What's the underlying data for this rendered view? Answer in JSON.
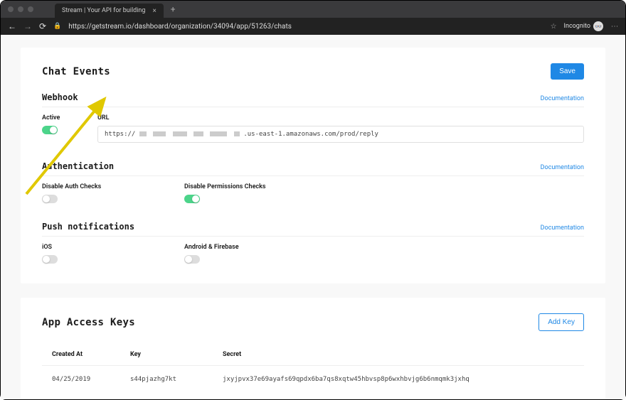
{
  "browser": {
    "tab_title": "Stream | Your API for building",
    "url": "https://getstream.io/dashboard/organization/34094/app/51263/chats",
    "incognito": "Incognito"
  },
  "chat_events": {
    "title": "Chat Events",
    "save_btn": "Save",
    "webhook": {
      "title": "Webhook",
      "doc": "Documentation",
      "active_label": "Active",
      "url_label": "URL",
      "url_prefix": "https://",
      "url_suffix": ".us-east-1.amazonaws.com/prod/reply",
      "active": true
    },
    "auth": {
      "title": "Authentication",
      "doc": "Documentation",
      "disable_auth": "Disable Auth Checks",
      "disable_perm": "Disable Permissions Checks"
    },
    "push": {
      "title": "Push notifications",
      "doc": "Documentation",
      "ios": "iOS",
      "android": "Android & Firebase"
    }
  },
  "keys": {
    "title": "App Access Keys",
    "add_btn": "Add Key",
    "cols": {
      "created": "Created At",
      "key": "Key",
      "secret": "Secret"
    },
    "rows": [
      {
        "created": "04/25/2019",
        "key": "s44pjazhg7kt",
        "secret": "jxyjpvx37e69ayafs69qpdx6ba7qs8xqtw45hbvsp8p6wxhbvjg6b6nmqmk3jxhq"
      }
    ]
  }
}
